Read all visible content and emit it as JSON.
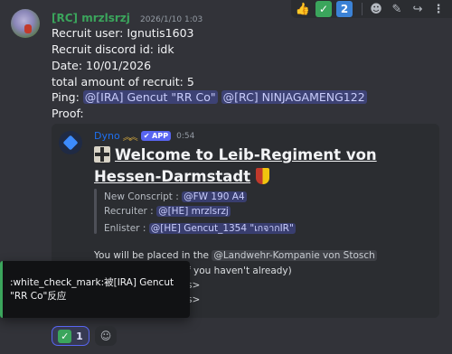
{
  "message": {
    "username": "[RC] mrzlsrzj",
    "timestamp": "2026/1/10 1:03",
    "lines": {
      "recruit_user": "Recruit user: Ignutis1603",
      "discord_id": "Recruit discord id: idk",
      "date": "Date: 10/01/2026",
      "total": "total amount of recruit: 5",
      "ping_label": "Ping:",
      "ping_mention_1": "@[IRA] Gencut \"RR Co\"",
      "ping_mention_2": "@[RC] NINJAGAMENG122",
      "proof": "Proof:"
    }
  },
  "toolbar": {
    "reaction_1_icon": "thumbs-up-icon",
    "reaction_2_icon": "check-mark-icon",
    "reaction_3": "2",
    "add_reaction_icon": "smiley-icon",
    "edit_icon": "pencil-icon",
    "reply_icon": "reply-arrow-icon",
    "more_icon": "more-icon"
  },
  "embed": {
    "bot_name": "Dyno",
    "app_badge": "✔ APP",
    "time": "0:54",
    "title": "Welcome to Leib-Regiment von Hessen-Darmstadt",
    "fields": [
      {
        "label": "New Conscript :",
        "mention": "@FW 190 A4"
      },
      {
        "label": "Recruiter :",
        "mention": "@[HE] mrzlsrzj"
      },
      {
        "label": "Enlister :",
        "mention": "@[HE] Gencut_1354 \"เกจากIR\""
      }
    ],
    "placed_text": "You will be placed in the",
    "placed_mention": "@Landwehr-Kompanie von Stosch",
    "partial_line_1": "f you haven't already)",
    "partial_line_2": "s>",
    "partial_line_3": "s>"
  },
  "tooltip": {
    "text": ":white_check_mark:被[IRA] Gencut \"RR Co\"反应"
  },
  "reactions": {
    "check_count": "1",
    "check_icon": "check-mark-icon",
    "add_icon": "add-reaction-icon"
  },
  "colors": {
    "background": "#323339",
    "username": "#3ba55c",
    "mention": "#c9cdfb",
    "accent": "#5865f2",
    "embed_bg": "#2b2d31"
  }
}
